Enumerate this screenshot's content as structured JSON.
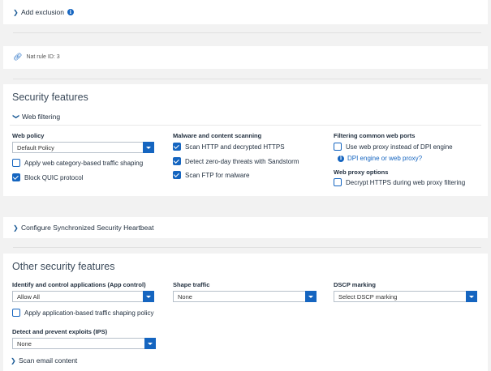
{
  "add_exclusion": {
    "label": "Add exclusion"
  },
  "nat_rule": {
    "label": "Nat rule ID: 3"
  },
  "security_features": {
    "title": "Security features",
    "web_filtering": {
      "label": "Web filtering",
      "web_policy": {
        "label": "Web policy",
        "selected": "Default Policy",
        "options": [
          {
            "label": "Apply web category-based traffic shaping",
            "checked": false
          },
          {
            "label": "Block QUIC protocol",
            "checked": true
          }
        ]
      },
      "malware": {
        "label": "Malware and content scanning",
        "options": [
          {
            "label": "Scan HTTP and decrypted HTTPS",
            "checked": true
          },
          {
            "label": "Detect zero-day threats with Sandstorm",
            "checked": true
          },
          {
            "label": "Scan FTP for malware",
            "checked": true
          }
        ]
      },
      "filtering_ports": {
        "label": "Filtering common web ports",
        "option": {
          "label": "Use web proxy instead of DPI engine",
          "checked": false
        },
        "help_link": "DPI engine or web proxy?"
      },
      "web_proxy": {
        "label": "Web proxy options",
        "option": {
          "label": "Decrypt HTTPS during web proxy filtering",
          "checked": false
        }
      }
    }
  },
  "heartbeat": {
    "label": "Configure Synchronized Security Heartbeat"
  },
  "other_features": {
    "title": "Other security features",
    "app_control": {
      "label": "Identify and control applications (App control)",
      "selected": "Allow All",
      "option": {
        "label": "Apply application-based traffic shaping policy",
        "checked": false
      }
    },
    "shape_traffic": {
      "label": "Shape traffic",
      "selected": "None"
    },
    "dscp": {
      "label": "DSCP marking",
      "selected": "Select DSCP marking"
    },
    "ips": {
      "label": "Detect and prevent exploits (IPS)",
      "selected": "None"
    },
    "scan_email": {
      "label": "Scan email content"
    }
  },
  "colors": {
    "accent": "#1565c0",
    "background": "#f2f2f2",
    "panel": "#ffffff"
  }
}
